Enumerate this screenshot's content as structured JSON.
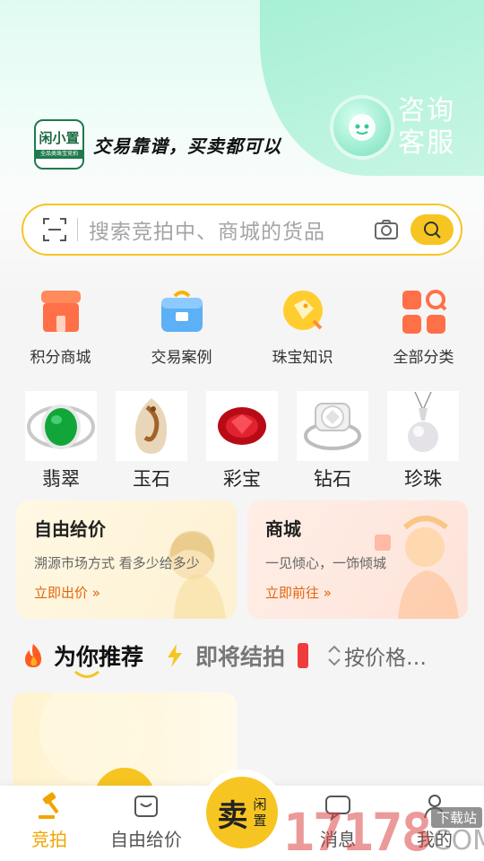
{
  "header": {
    "slogan": "交易靠谱，买卖都可以",
    "logo_text": "闲小置",
    "logo_sub": "全品类珠宝竞拍",
    "service_line1": "咨询",
    "service_line2": "客服"
  },
  "search": {
    "placeholder": "搜索竞拍中、商城的货品"
  },
  "quick_links": [
    {
      "label": "积分商城",
      "icon": "store-icon"
    },
    {
      "label": "交易案例",
      "icon": "case-box-icon"
    },
    {
      "label": "珠宝知识",
      "icon": "knowledge-tag-icon"
    },
    {
      "label": "全部分类",
      "icon": "category-grid-icon"
    }
  ],
  "categories": [
    {
      "label": "翡翠"
    },
    {
      "label": "玉石"
    },
    {
      "label": "彩宝"
    },
    {
      "label": "钻石"
    },
    {
      "label": "珍珠"
    }
  ],
  "promo_cards": {
    "free_bid": {
      "title": "自由给价",
      "subtitle": "溯源市场方式 看多少给多少",
      "link": "立即出价 »"
    },
    "mall": {
      "title": "商城",
      "subtitle": "一见倾心，一饰倾城",
      "link": "立即前往 »"
    }
  },
  "feed_tabs": {
    "recommend": "为你推荐",
    "ending_soon": "即将结拍",
    "sort": "按价格…"
  },
  "bottom_nav": {
    "auction": "竞拍",
    "free_bid": "自由给价",
    "sell_big": "卖",
    "sell_small_1": "闲",
    "sell_small_2": "置",
    "messages": "消息",
    "mine": "我的"
  },
  "watermark": {
    "number": "17178",
    "suffix": "COM",
    "tag": "下载站"
  },
  "colors": {
    "accent": "#f7c521",
    "mint": "#a7f0d5",
    "link_orange": "#e2650c"
  }
}
